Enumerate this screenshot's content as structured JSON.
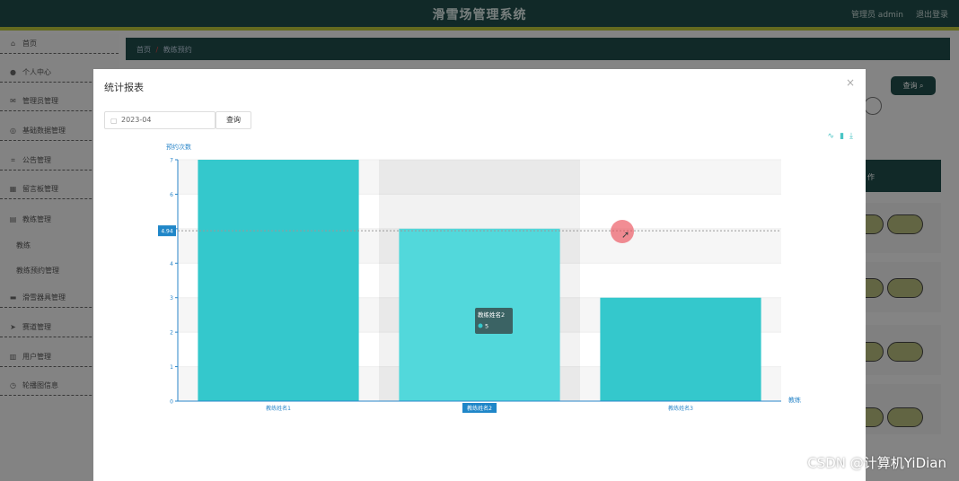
{
  "header": {
    "title": "滑雪场管理系统",
    "user": "管理员 admin",
    "logout": "退出登录"
  },
  "sidebar": {
    "items": [
      {
        "label": "首页",
        "icon": "home-icon",
        "glyph": "⌂"
      },
      {
        "label": "个人中心",
        "icon": "user-icon",
        "glyph": "●"
      },
      {
        "label": "管理员管理",
        "icon": "mail-icon",
        "glyph": "✉"
      },
      {
        "label": "基础数据管理",
        "icon": "compass-icon",
        "glyph": "◎"
      },
      {
        "label": "公告管理",
        "icon": "crop-icon",
        "glyph": "⌗"
      },
      {
        "label": "留言板管理",
        "icon": "store-icon",
        "glyph": "▦"
      },
      {
        "label": "教练管理",
        "icon": "list-icon",
        "glyph": "▤"
      },
      {
        "label": "教练",
        "icon": "",
        "glyph": ""
      },
      {
        "label": "教练预约管理",
        "icon": "",
        "glyph": ""
      },
      {
        "label": "滑雪器具管理",
        "icon": "box-icon",
        "glyph": "▬"
      },
      {
        "label": "赛道管理",
        "icon": "send-icon",
        "glyph": "➤"
      },
      {
        "label": "用户管理",
        "icon": "doc-icon",
        "glyph": "▥"
      },
      {
        "label": "轮播图信息",
        "icon": "clock-icon",
        "glyph": "◷"
      }
    ]
  },
  "breadcrumb": {
    "home": "首页",
    "sep": "/",
    "current": "教练预约"
  },
  "background": {
    "query_label": "查询",
    "table_col": "作"
  },
  "modal": {
    "title": "统计报表",
    "close": "×",
    "date_value": "2023-04",
    "query_label": "查询",
    "tools": [
      "line-chart-icon",
      "bar-chart-icon",
      "download-icon"
    ]
  },
  "chart_data": {
    "type": "bar",
    "ylabel": "预约次数",
    "xlabel": "教练",
    "categories": [
      "教练姓名1",
      "教练姓名2",
      "教练姓名3"
    ],
    "values": [
      7,
      5,
      3
    ],
    "ylim": [
      0,
      7
    ],
    "yticks": [
      0,
      1,
      2,
      3,
      4,
      5,
      6,
      7
    ],
    "color": "#34c8cc",
    "highlight_color": "#52d8db",
    "axis_color": "#2a86c9",
    "crosshair_value": "4.94",
    "tooltip": {
      "title": "教练姓名2",
      "value": "5"
    },
    "grid": true
  },
  "watermark": "CSDN @计算机YiDian"
}
